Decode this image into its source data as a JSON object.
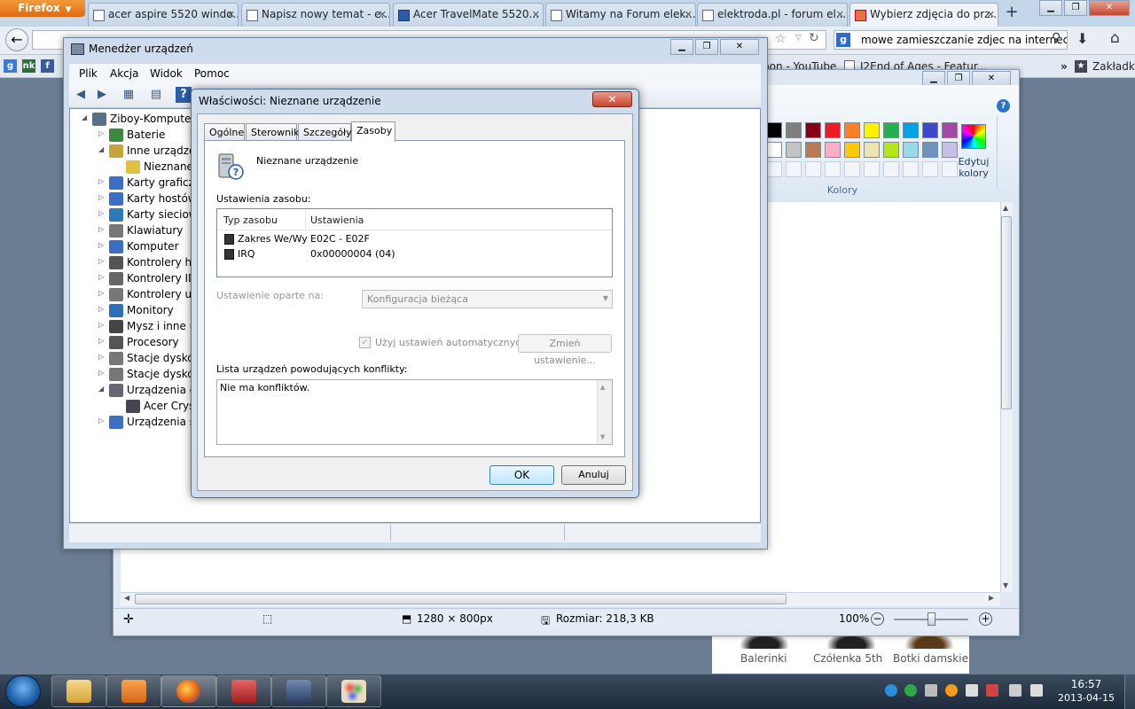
{
  "firefox": {
    "menu_button": "Firefox",
    "tabs": [
      {
        "label": "acer aspire 5520 windo..."
      },
      {
        "label": "Napisz nowy temat - e..."
      },
      {
        "label": "Acer TravelMate 5520..."
      },
      {
        "label": "Witamy na Forum elek..."
      },
      {
        "label": "elektroda.pl - forum el..."
      },
      {
        "label": "Wybierz zdjęcia do prz..."
      }
    ],
    "new_tab": "+",
    "search_text": "mowe zamieszczanie zdjec na internecie",
    "bookmarks": [
      {
        "label": "pon - YouTube"
      },
      {
        "label": "I2End of Ages - Featur..."
      }
    ],
    "bookmarks_more": "»",
    "bookmarks_label": "Zakładki"
  },
  "paint": {
    "colors_label": "Kolory",
    "edit_colors": "Edytuj kolory",
    "palette_row1": [
      "#000000",
      "#7f7f7f",
      "#880015",
      "#ed1c24",
      "#ff7f27",
      "#fff200",
      "#22b14c",
      "#00a2e8",
      "#3f48cc",
      "#a349a4"
    ],
    "palette_row2": [
      "#ffffff",
      "#c3c3c3",
      "#b97a57",
      "#ffaec9",
      "#ffc90e",
      "#efe4b0",
      "#b5e61d",
      "#99d9ea",
      "#7092be",
      "#c8bfe7"
    ],
    "status": {
      "dimensions": "1280 × 800px",
      "size": "Rozmiar: 218,3 KB",
      "zoom": "100%"
    }
  },
  "website": {
    "shoes": [
      "Balerinki",
      "Czółenka 5th",
      "Botki damskie"
    ]
  },
  "device_manager": {
    "title": "Menedżer urządzeń",
    "menu": [
      "Plik",
      "Akcja",
      "Widok",
      "Pomoc"
    ],
    "tree": [
      {
        "label": "Ziboy-Komputer",
        "level": 0,
        "expander": "◢"
      },
      {
        "label": "Baterie",
        "level": 1,
        "expander": "▷"
      },
      {
        "label": "Inne urządzen",
        "level": 1,
        "expander": "◢"
      },
      {
        "label": "Nieznane",
        "level": 2,
        "expander": ""
      },
      {
        "label": "Karty graficzn",
        "level": 1,
        "expander": "▷"
      },
      {
        "label": "Karty hostów",
        "level": 1,
        "expander": "▷"
      },
      {
        "label": "Karty sieciowe",
        "level": 1,
        "expander": "▷"
      },
      {
        "label": "Klawiatury",
        "level": 1,
        "expander": "▷"
      },
      {
        "label": "Komputer",
        "level": 1,
        "expander": "▷"
      },
      {
        "label": "Kontrolery ho",
        "level": 1,
        "expander": "▷"
      },
      {
        "label": "Kontrolery IDE",
        "level": 1,
        "expander": "▷"
      },
      {
        "label": "Kontrolery un",
        "level": 1,
        "expander": "▷"
      },
      {
        "label": "Monitory",
        "level": 1,
        "expander": "▷"
      },
      {
        "label": "Mysz i inne ur",
        "level": 1,
        "expander": "▷"
      },
      {
        "label": "Procesory",
        "level": 1,
        "expander": "▷"
      },
      {
        "label": "Stacje dysków",
        "level": 1,
        "expander": "▷"
      },
      {
        "label": "Stacje dysków",
        "level": 1,
        "expander": "▷"
      },
      {
        "label": "Urządzenia do",
        "level": 1,
        "expander": "◢"
      },
      {
        "label": "Acer Cryst",
        "level": 2,
        "expander": ""
      },
      {
        "label": "Urządzenia sy",
        "level": 1,
        "expander": "▷"
      }
    ]
  },
  "dialog": {
    "title": "Właściwości: Nieznane urządzenie",
    "close": "✕",
    "tabs": [
      "Ogólne",
      "Sterownik",
      "Szczegóły",
      "Zasoby"
    ],
    "active_tab": "Zasoby",
    "device_name": "Nieznane urządzenie",
    "resource_settings_label": "Ustawienia zasobu:",
    "columns": [
      "Typ zasobu",
      "Ustawienia"
    ],
    "resources": [
      {
        "type": "Zakres We/Wy",
        "setting": "E02C - E02F"
      },
      {
        "type": "IRQ",
        "setting": "0x00000004 (04)"
      }
    ],
    "based_on_label": "Ustawienie oparte na:",
    "based_on_value": "Konfiguracja bieżąca",
    "auto_settings_label": "Użyj ustawień automatycznych",
    "auto_settings_checked": true,
    "change_button": "Zmień ustawienie...",
    "conflict_label": "Lista urządzeń powodujących konflikty:",
    "conflict_text": "Nie ma konfliktów.",
    "ok": "OK",
    "cancel": "Anuluj"
  },
  "taskbar": {
    "time": "16:57",
    "date": "2013-04-15"
  }
}
